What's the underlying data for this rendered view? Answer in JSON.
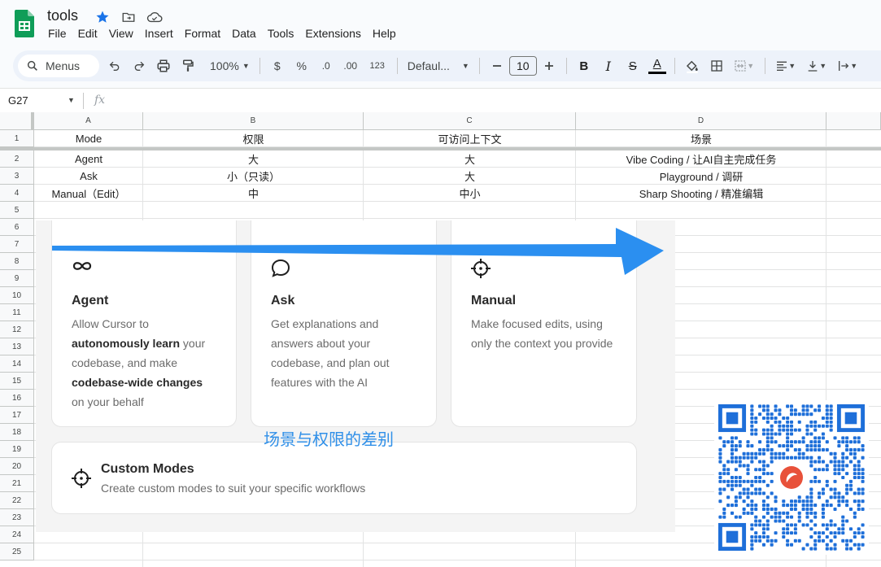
{
  "app": {
    "doc_title": "tools",
    "menu": [
      "File",
      "Edit",
      "View",
      "Insert",
      "Format",
      "Data",
      "Tools",
      "Extensions",
      "Help"
    ]
  },
  "toolbar": {
    "search_label": "Menus",
    "zoom": "100%",
    "currency": "$",
    "percent": "%",
    "dec_decrease": ".0",
    "dec_increase": ".00",
    "number_format": "123",
    "font": "Defaul...",
    "font_size": "10",
    "bold": "B",
    "italic": "I",
    "strike": "S",
    "text_color": "A",
    "text_color_value": "#000000"
  },
  "formula_bar": {
    "name_box": "G27",
    "fx": "fx"
  },
  "sheet": {
    "columns": [
      "A",
      "B",
      "C",
      "D"
    ],
    "rows": [
      "1",
      "2",
      "3",
      "4",
      "5",
      "6",
      "7",
      "8",
      "9",
      "10",
      "11",
      "12",
      "13",
      "14",
      "15",
      "16",
      "17",
      "18",
      "19",
      "20",
      "21",
      "22",
      "23",
      "24",
      "25"
    ],
    "header": [
      "Mode",
      "权限",
      "可访问上下文",
      "场景"
    ],
    "data": [
      [
        "Agent",
        "大",
        "大",
        "Vibe Coding / 让AI自主完成任务"
      ],
      [
        "Ask",
        "小（只读）",
        "大",
        "Playground / 调研"
      ],
      [
        "Manual（Edit）",
        "中",
        "中小",
        "Sharp Shooting / 精准编辑"
      ]
    ]
  },
  "embedded_image": {
    "cards": [
      {
        "icon": "infinity-icon",
        "title": "Agent",
        "desc_lines": [
          [
            {
              "t": "Allow Cursor to",
              "b": false
            }
          ],
          [
            {
              "t": "autonomously learn",
              "b": true
            },
            {
              "t": " your",
              "b": false
            }
          ],
          [
            {
              "t": "codebase, and make",
              "b": false
            }
          ],
          [
            {
              "t": "codebase-wide changes",
              "b": true
            }
          ],
          [
            {
              "t": "on your behalf",
              "b": false
            }
          ]
        ]
      },
      {
        "icon": "chat-bubble-icon",
        "title": "Ask",
        "desc_lines": [
          [
            {
              "t": "Get explanations and",
              "b": false
            }
          ],
          [
            {
              "t": "answers about your",
              "b": false
            }
          ],
          [
            {
              "t": "codebase, and plan out",
              "b": false
            }
          ],
          [
            {
              "t": "features with the AI",
              "b": false
            }
          ]
        ]
      },
      {
        "icon": "crosshair-icon",
        "title": "Manual",
        "desc_lines": [
          [
            {
              "t": "Make focused edits, using",
              "b": false
            }
          ],
          [
            {
              "t": "only the context you provide",
              "b": false
            }
          ]
        ]
      }
    ],
    "custom_modes": {
      "icon": "crosshair-icon",
      "title": "Custom Modes",
      "desc": "Create custom modes to suit your specific workflows"
    },
    "caption": "场景与权限的差别",
    "arrow_color": "#2b8ff0"
  },
  "colors": {
    "sheets_green": "#0f9d58",
    "toolbar_bg": "#edf2fa",
    "star_blue": "#1a73e8",
    "qr_blue": "#1e6fd9"
  }
}
